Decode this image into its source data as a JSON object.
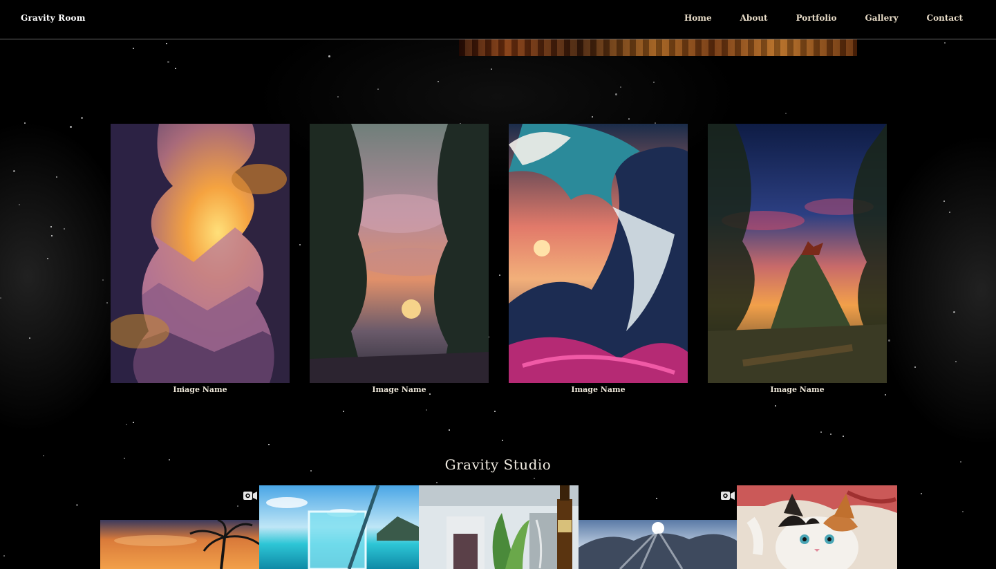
{
  "header": {
    "brand": "Gravity Room",
    "nav": [
      {
        "label": "Home"
      },
      {
        "label": "About"
      },
      {
        "label": "Portfolio"
      },
      {
        "label": "Gallery"
      },
      {
        "label": "Contact"
      }
    ]
  },
  "gallery": {
    "cards": [
      {
        "caption": "Image Name",
        "scene": "mountain-sunset-valley"
      },
      {
        "caption": "Image Name",
        "scene": "forest-sunset-clouds"
      },
      {
        "caption": "Image Name",
        "scene": "colorful-great-wave"
      },
      {
        "caption": "Image Name",
        "scene": "dragon-on-hill-dusk"
      }
    ]
  },
  "studio": {
    "title": "Gravity Studio",
    "tiles": [
      {
        "scene": "palm-sunset",
        "has_video": true
      },
      {
        "scene": "blue-drink-beach",
        "has_video": false
      },
      {
        "scene": "building-plants-bottle",
        "has_video": false
      },
      {
        "scene": "winter-trees-sun",
        "has_video": true
      },
      {
        "scene": "calico-kitten",
        "has_video": false
      }
    ]
  },
  "icons": {
    "video": "video-camera-icon"
  }
}
